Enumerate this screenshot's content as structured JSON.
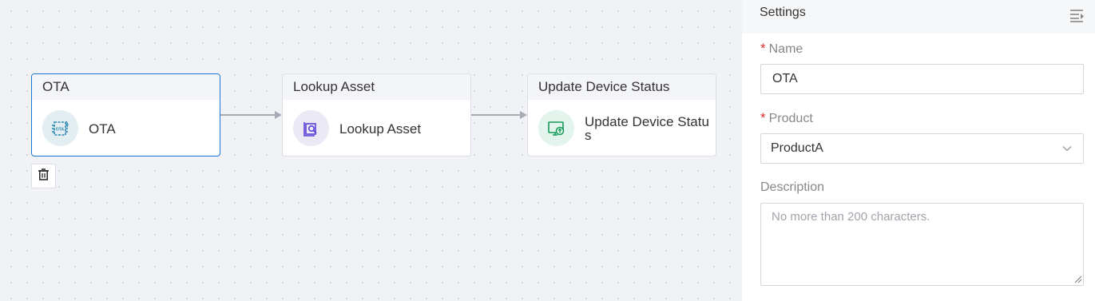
{
  "canvas": {
    "nodes": [
      {
        "header": "OTA",
        "label": "OTA",
        "icon": "ota-chip-icon",
        "icon_bg": "#e3eef3",
        "icon_color": "#2b88b3",
        "selected": true
      },
      {
        "header": "Lookup Asset",
        "label": "Lookup Asset",
        "icon": "lookup-asset-icon",
        "icon_bg": "#ece9f7",
        "icon_color": "#5b3fd6",
        "selected": false
      },
      {
        "header": "Update Device Status",
        "label": "Update Device Status",
        "icon": "update-device-status-icon",
        "icon_bg": "#e2f4ec",
        "icon_color": "#17995b",
        "selected": false
      }
    ],
    "delete_icon": "trash-icon"
  },
  "settings": {
    "title": "Settings",
    "toggle_icon": "collapse-panel-icon",
    "name_label": "Name",
    "name_value": "OTA",
    "product_label": "Product",
    "product_value": "ProductA",
    "description_label": "Description",
    "description_placeholder": "No more than 200 characters.",
    "description_value": ""
  },
  "colors": {
    "selected_border": "#1976d2",
    "required_marker": "#e02e2e",
    "connector": "#a7abb3"
  }
}
